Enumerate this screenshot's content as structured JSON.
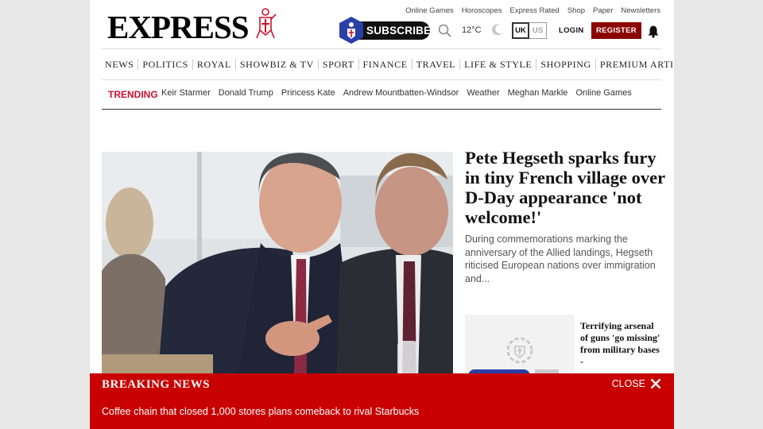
{
  "top_links": [
    "Online Games",
    "Horoscopes",
    "Express Rated",
    "Shop",
    "Paper",
    "Newsletters"
  ],
  "logo": {
    "text": "EXPRESS"
  },
  "header": {
    "subscribe_label": "SUBSCRIBE",
    "temperature": "12°C",
    "edition_uk": "UK",
    "edition_us": "US",
    "login_label": "LOGIN",
    "register_label": "REGISTER",
    "icons": [
      "search-icon",
      "moon-icon",
      "bell-icon"
    ]
  },
  "nav": {
    "items": [
      "NEWS",
      "POLITICS",
      "ROYAL",
      "SHOWBIZ & TV",
      "SPORT",
      "FINANCE",
      "TRAVEL",
      "LIFE & STYLE",
      "SHOPPING",
      "PREMIUM ARTICLES"
    ]
  },
  "trending": {
    "label": "TRENDING",
    "items": [
      "Keir Starmer",
      "Donald Trump",
      "Princess Kate",
      "Andrew Mountbatten-Windsor",
      "Weather",
      "Meghan Markle",
      "Online Games"
    ]
  },
  "lead_story": {
    "headline": "Pete Hegseth sparks fury in tiny French village over D-Day appearance 'not welcome!'",
    "standfirst": "During commemorations marking the anniversary of the Allied landings, Hegseth riticised European nations over immigration and..."
  },
  "secondary_story": {
    "headline": "Terrifying arsenal of guns 'go missing' from military bases -"
  },
  "breaking_news": {
    "title": "BREAKING NEWS",
    "close_label": "CLOSE",
    "text": "Coffee chain that closed 1,000 stores plans comeback to rival Starbucks"
  },
  "colors": {
    "brand_red": "#c8102e",
    "register_bg": "#8b0000",
    "breaking_bg": "#c80000"
  }
}
